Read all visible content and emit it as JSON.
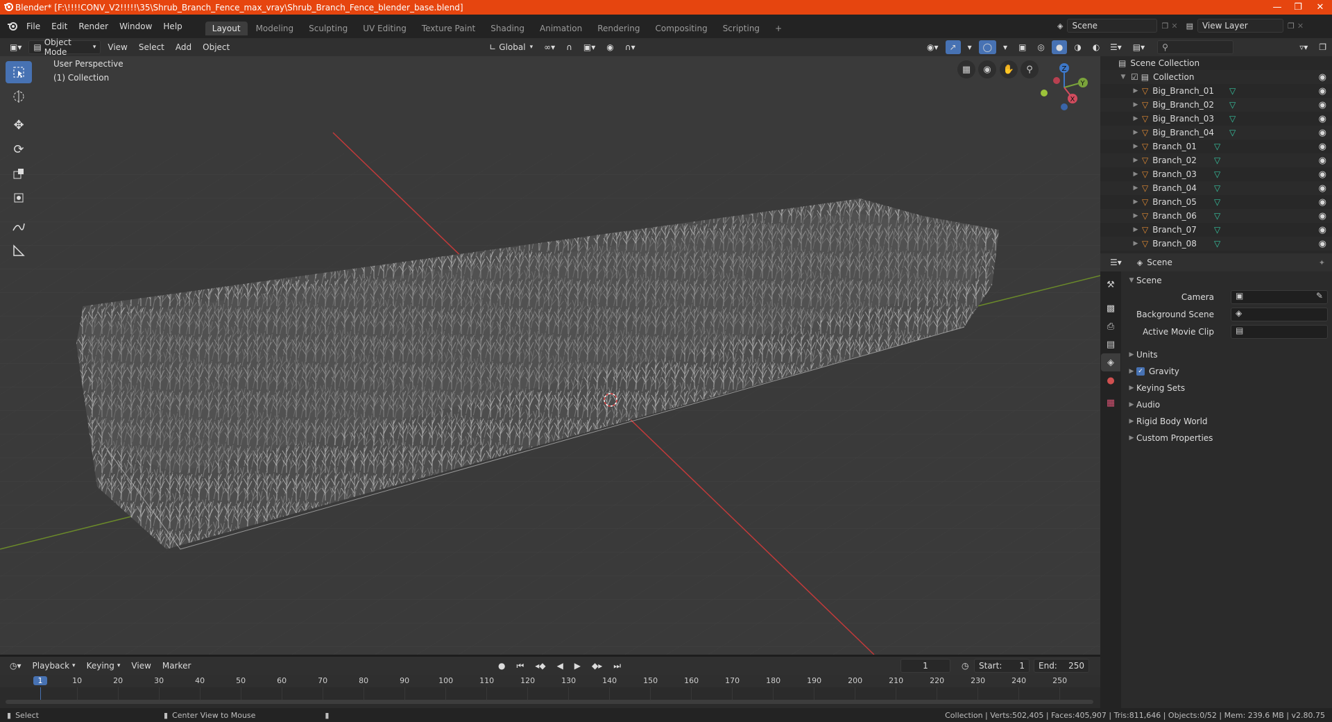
{
  "window": {
    "title": "Blender* [F:\\!!!!CONV_V2!!!!!\\35\\Shrub_Branch_Fence_max_vray\\Shrub_Branch_Fence_blender_base.blend]",
    "minimize": "—",
    "maximize": "❐",
    "close": "✕"
  },
  "menu": {
    "items": [
      "File",
      "Edit",
      "Render",
      "Window",
      "Help"
    ],
    "workspaces": [
      "Layout",
      "Modeling",
      "Sculpting",
      "UV Editing",
      "Texture Paint",
      "Shading",
      "Animation",
      "Rendering",
      "Compositing",
      "Scripting"
    ],
    "add_tab": "+",
    "scene_label": "Scene",
    "view_layer_label": "View Layer"
  },
  "viewport_header": {
    "mode": "Object Mode",
    "view": "View",
    "select": "Select",
    "add": "Add",
    "object": "Object",
    "orientation": "Global"
  },
  "viewport": {
    "perspective": "User Perspective",
    "collection": "(1) Collection",
    "gizmo": {
      "z": "Z",
      "y": "Y",
      "x": "X"
    }
  },
  "outliner": {
    "search_placeholder": "",
    "root": "Scene Collection",
    "collection": "Collection",
    "items": [
      "Big_Branch_01",
      "Big_Branch_02",
      "Big_Branch_03",
      "Big_Branch_04",
      "Branch_01",
      "Branch_02",
      "Branch_03",
      "Branch_04",
      "Branch_05",
      "Branch_06",
      "Branch_07",
      "Branch_08"
    ]
  },
  "properties": {
    "header": "Scene",
    "section": "Scene",
    "camera_label": "Camera",
    "background_label": "Background Scene",
    "movie_clip_label": "Active Movie Clip",
    "panels": [
      "Units",
      "Gravity",
      "Keying Sets",
      "Audio",
      "Rigid Body World",
      "Custom Properties"
    ]
  },
  "timeline": {
    "playback": "Playback",
    "keying": "Keying",
    "view": "View",
    "marker": "Marker",
    "current_frame": "1",
    "start_label": "Start:",
    "start": "1",
    "end_label": "End:",
    "end": "250",
    "ticks": [
      "1",
      "10",
      "20",
      "30",
      "40",
      "50",
      "60",
      "70",
      "80",
      "90",
      "100",
      "110",
      "120",
      "130",
      "140",
      "150",
      "160",
      "170",
      "180",
      "190",
      "200",
      "210",
      "220",
      "230",
      "240",
      "250"
    ]
  },
  "status": {
    "select": "Select",
    "center": "Center View to Mouse",
    "stats": "Collection | Verts:502,405 | Faces:405,907 | Tris:811,646 | Objects:0/52 | Mem: 239.6 MB | v2.80.75"
  },
  "colors": {
    "title_bar": "#e6450f",
    "accent": "#4772b3",
    "object_icon": "#e08a33",
    "mesh_icon": "#36c4a0"
  }
}
